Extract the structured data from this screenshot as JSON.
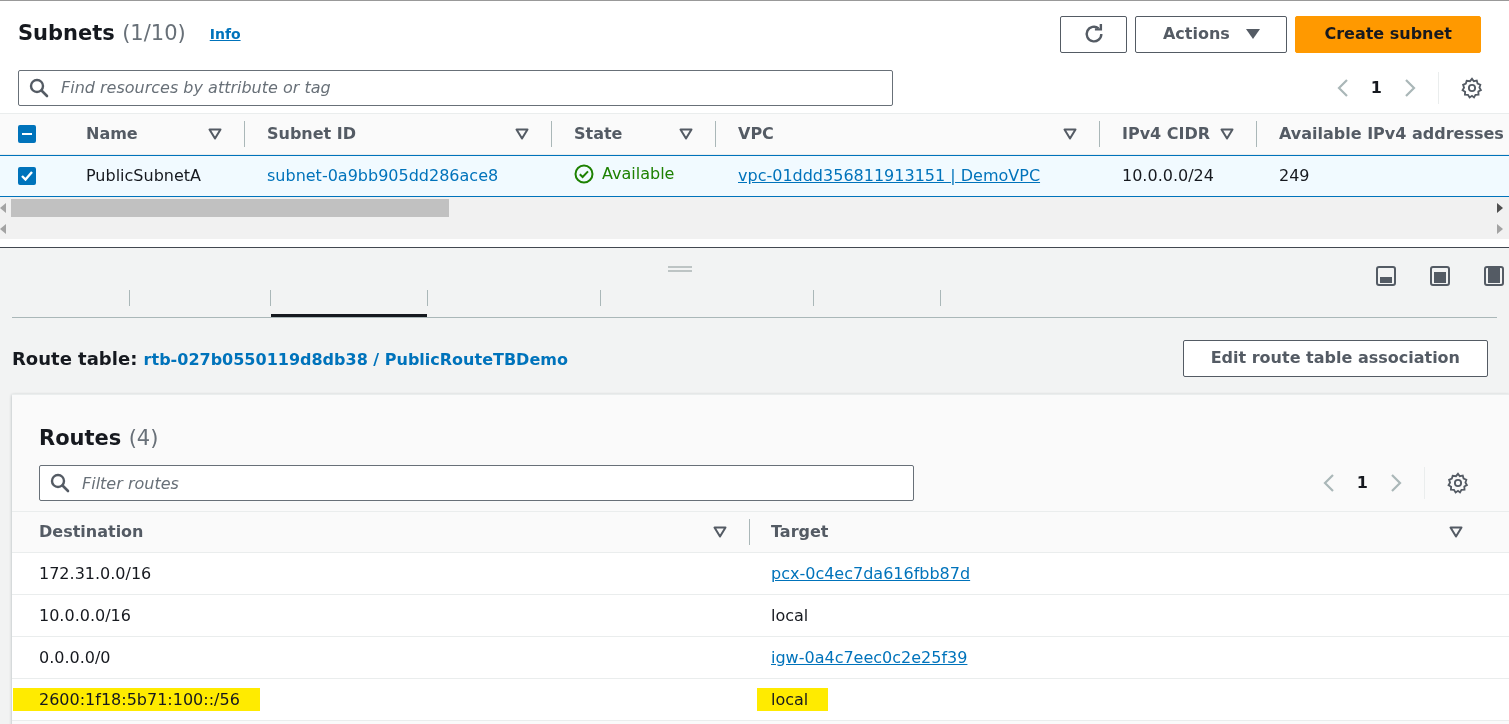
{
  "subnets": {
    "title": "Subnets",
    "count": "(1/10)",
    "info": "Info",
    "search": {
      "placeholder": "Find resources by attribute or tag"
    },
    "actions": "Actions",
    "create": "Create subnet",
    "page": "1",
    "all_indeterminate": true,
    "columns": [
      "Name",
      "Subnet ID",
      "State",
      "VPC",
      "IPv4 CIDR",
      "Available IPv4 addresses"
    ],
    "rows": [
      {
        "selected": true,
        "name": "PublicSubnetA",
        "subnet_id": "subnet-0a9bb905dd286ace8",
        "state": "Available",
        "vpc": "vpc-01ddd356811913151 | DemoVPC",
        "cidr": "10.0.0.0/24",
        "available": "249"
      }
    ]
  },
  "tabs": [
    {
      "selected": false
    },
    {
      "selected": false
    },
    {
      "selected": true
    },
    {
      "selected": false
    },
    {
      "selected": false
    },
    {
      "selected": false
    },
    {
      "selected": false
    }
  ],
  "route_table": {
    "label": "Route table:",
    "value": "rtb-027b0550119d8db38 / PublicRouteTBDemo",
    "edit_button": "Edit route table association"
  },
  "routes": {
    "title": "Routes",
    "count": "(4)",
    "search": {
      "placeholder": "Filter routes"
    },
    "page": "1",
    "columns": [
      "Destination",
      "Target"
    ],
    "rows": [
      {
        "destination": "172.31.0.0/16",
        "target": "pcx-0c4ec7da616fbb87d",
        "target_link": true,
        "highlighted": false
      },
      {
        "destination": "10.0.0.0/16",
        "target": "local",
        "target_link": false,
        "highlighted": false
      },
      {
        "destination": "0.0.0.0/0",
        "target": "igw-0a4c7eec0c2e25f39",
        "target_link": true,
        "highlighted": false
      },
      {
        "destination": "2600:1f18:5b71:100::/56",
        "target": "local",
        "target_link": false,
        "highlighted": true
      }
    ]
  }
}
